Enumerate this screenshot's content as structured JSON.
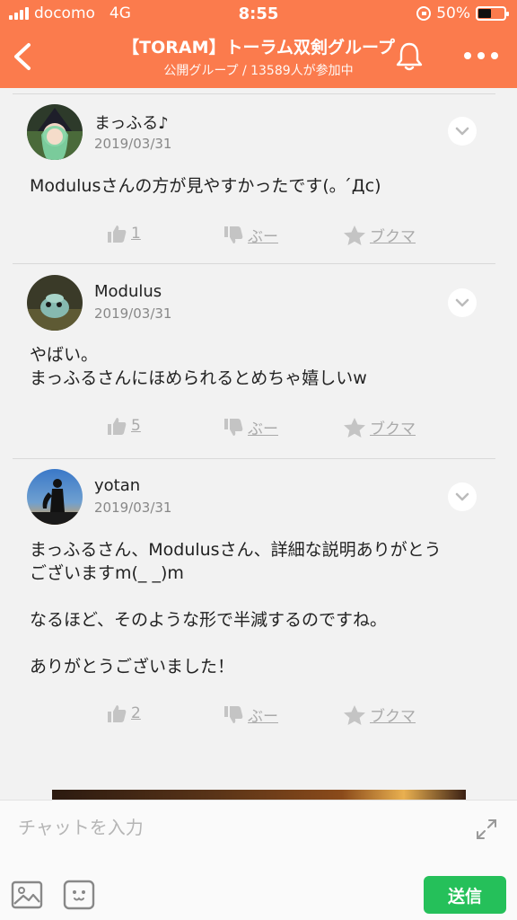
{
  "status_bar": {
    "carrier": "docomo",
    "network": "4G",
    "time": "8:55",
    "battery_percent": "50%",
    "battery_level": 0.5
  },
  "nav": {
    "title": "【TORAM】トーラム双剣グループ",
    "subtitle": "公開グループ / 13589人が参加中",
    "back_icon": "chevron-left-icon",
    "bell_icon": "bell-icon",
    "more_icon": "more-dots-icon"
  },
  "posts": [
    {
      "name": "まっふる♪",
      "date": "2019/03/31",
      "body": [
        "Modulusさんの方が見やすかったです(｡ ´Дc)"
      ],
      "likes": "1",
      "boo_label": "ぶー",
      "bookmark_label": "ブクマ"
    },
    {
      "name": "Modulus",
      "date": "2019/03/31",
      "body": [
        "やばい。",
        "まっふるさんにほめられるとめちゃ嬉しいw"
      ],
      "likes": "5",
      "boo_label": "ぶー",
      "bookmark_label": "ブクマ"
    },
    {
      "name": "yotan",
      "date": "2019/03/31",
      "body": [
        "まっふるさん、Modulusさん、詳細な説明ありがとう",
        "ございますm(_ _)m",
        "",
        "なるほど、そのような形で半減するのですね。",
        "",
        "ありがとうございました！"
      ],
      "likes": "2",
      "boo_label": "ぶー",
      "bookmark_label": "ブクマ"
    }
  ],
  "compose": {
    "placeholder": "チャットを入力",
    "send_label": "送信"
  },
  "colors": {
    "header": "#fb7b4d",
    "send": "#25c05a",
    "action_gray": "#aaaaaa"
  }
}
